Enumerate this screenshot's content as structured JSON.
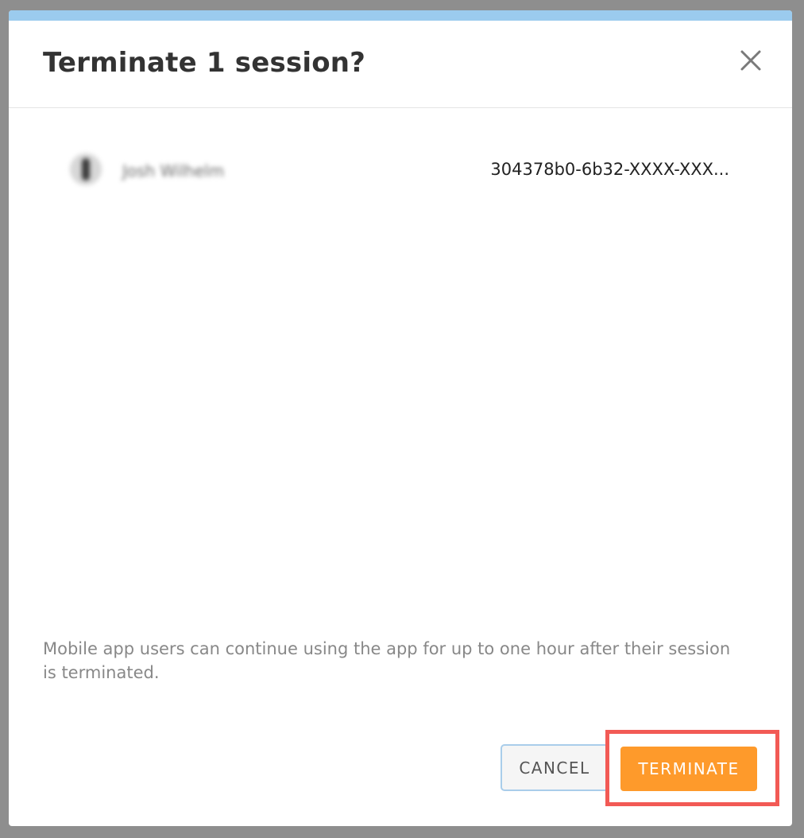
{
  "dialog": {
    "title": "Terminate 1 session?",
    "close_icon": "close-icon"
  },
  "sessions": [
    {
      "user_name": "Josh Wilhelm",
      "session_id": "304378b0-6b32-XXXX-XXX..."
    }
  ],
  "info_text": "Mobile app users can continue using the app for up to one hour after their session is terminated.",
  "buttons": {
    "cancel_label": "CANCEL",
    "terminate_label": "TERMINATE"
  },
  "colors": {
    "accent_bar": "#9bcbee",
    "terminate_button": "#fe9a2b",
    "highlight_box": "#f25a55",
    "cancel_border": "#a9cdea"
  }
}
